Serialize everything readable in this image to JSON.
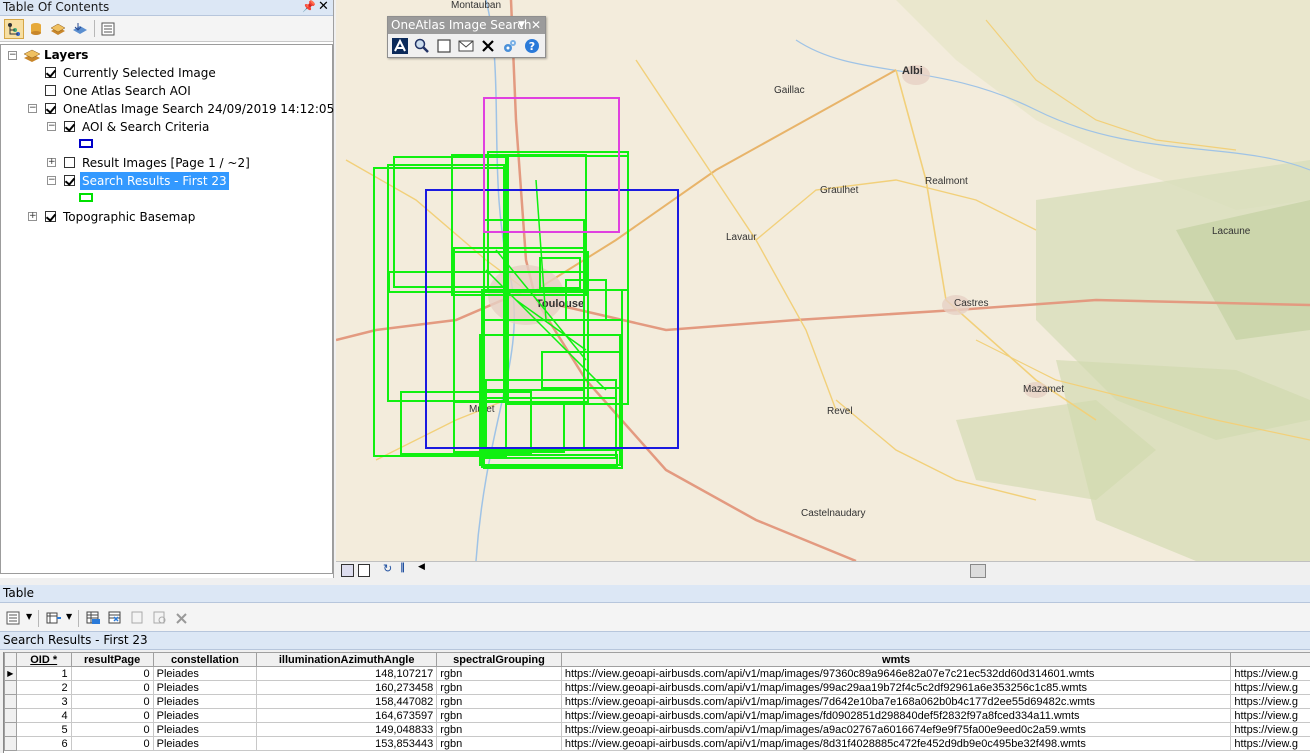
{
  "toc": {
    "title": "Table Of Contents",
    "tree": {
      "root_label": "Layers",
      "currently_selected": "Currently Selected Image",
      "aoi": "One Atlas Search AOI",
      "search_group": "OneAtlas Image Search 24/09/2019 14:12:05",
      "criteria": "AOI & Search Criteria",
      "result_images": "Result Images [Page 1 / ~2]",
      "search_results": "Search Results - First 23",
      "basemap": "Topographic Basemap"
    },
    "colors": {
      "aoi_swatch": "#0000c8",
      "results_swatch": "#00e000",
      "selection": "#3399ff"
    }
  },
  "search_toolbar": {
    "title": "OneAtlas Image Search",
    "icons": [
      "airbus-logo-icon",
      "zoom-search-icon",
      "rectangle-select-icon",
      "envelope-icon",
      "delete-icon",
      "settings-icon",
      "help-icon"
    ]
  },
  "map": {
    "cities": [
      {
        "name": "Montauban"
      },
      {
        "name": "Albi"
      },
      {
        "name": "Gaillac"
      },
      {
        "name": "Graulhet"
      },
      {
        "name": "Realmont"
      },
      {
        "name": "Lavaur"
      },
      {
        "name": "Lacaune"
      },
      {
        "name": "Toulouse"
      },
      {
        "name": "Castres"
      },
      {
        "name": "Muret"
      },
      {
        "name": "Mazamet"
      },
      {
        "name": "Revel"
      },
      {
        "name": "Castelnaudary"
      }
    ],
    "colors": {
      "aoi": "#1a1ae0",
      "results": "#10f010",
      "selected": "#e040e0"
    }
  },
  "table": {
    "window_title": "Table",
    "tab_label": "Search Results - First 23",
    "columns": [
      "OID *",
      "resultPage",
      "constellation",
      "illuminationAzimuthAngle",
      "spectralGrouping",
      "wmts",
      ""
    ],
    "rows": [
      {
        "oid": "1",
        "page": "0",
        "const": "Pleiades",
        "angle": "148,107217",
        "spec": "rgbn",
        "wmts": "https://view.geoapi-airbusds.com/api/v1/map/images/97360c89a9646e82a07e7c21ec532dd60d314601.wmts",
        "extra": "https://view.g"
      },
      {
        "oid": "2",
        "page": "0",
        "const": "Pleiades",
        "angle": "160,273458",
        "spec": "rgbn",
        "wmts": "https://view.geoapi-airbusds.com/api/v1/map/images/99ac29aa19b72f4c5c2df92961a6e353256c1c85.wmts",
        "extra": "https://view.g"
      },
      {
        "oid": "3",
        "page": "0",
        "const": "Pleiades",
        "angle": "158,447082",
        "spec": "rgbn",
        "wmts": "https://view.geoapi-airbusds.com/api/v1/map/images/7d642e10ba7e168a062b0b4c177d2ee55d69482c.wmts",
        "extra": "https://view.g"
      },
      {
        "oid": "4",
        "page": "0",
        "const": "Pleiades",
        "angle": "164,673597",
        "spec": "rgbn",
        "wmts": "https://view.geoapi-airbusds.com/api/v1/map/images/fd0902851d298840def5f2832f97a8fced334a11.wmts",
        "extra": "https://view.g"
      },
      {
        "oid": "5",
        "page": "0",
        "const": "Pleiades",
        "angle": "149,048833",
        "spec": "rgbn",
        "wmts": "https://view.geoapi-airbusds.com/api/v1/map/images/a9ac02767a6016674ef9e9f75fa00e9eed0c2a59.wmts",
        "extra": "https://view.g"
      },
      {
        "oid": "6",
        "page": "0",
        "const": "Pleiades",
        "angle": "153,853443",
        "spec": "rgbn",
        "wmts": "https://view.geoapi-airbusds.com/api/v1/map/images/8d31f4028885c472fe452d9db9e0c495be32f498.wmts",
        "extra": "https://view.g"
      }
    ]
  }
}
